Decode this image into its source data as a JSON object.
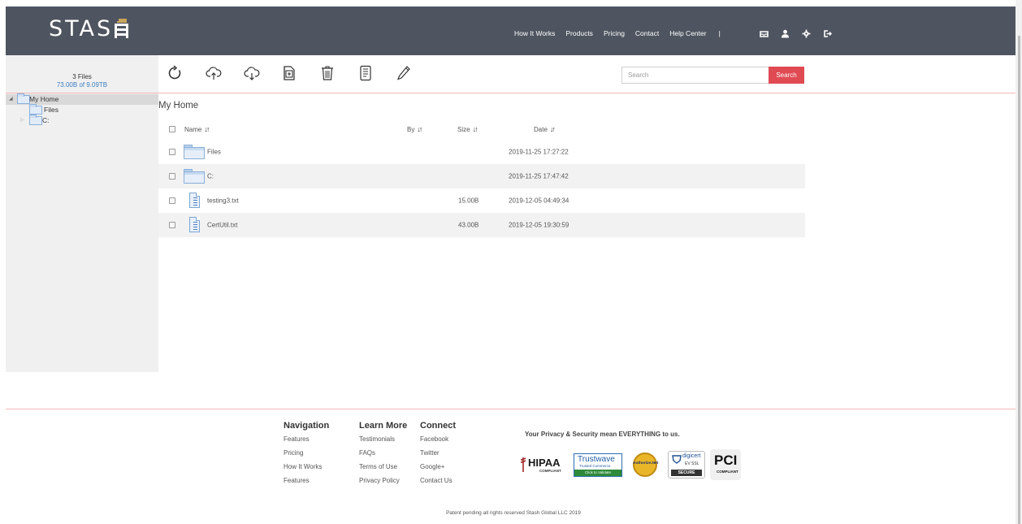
{
  "brand": {
    "logo_text": "STAS"
  },
  "topnav": {
    "links": [
      "How It Works",
      "Products",
      "Pricing",
      "Contact",
      "Help Center"
    ],
    "separator": "|",
    "icons": [
      "inbox-icon",
      "user-icon",
      "gear-icon",
      "logout-icon"
    ]
  },
  "sidebar": {
    "file_count": "3 Files",
    "usage": "73.00B of 9.09TB",
    "tree": [
      {
        "label": "My Home",
        "expanded": true,
        "selected": true
      },
      {
        "label": "Files",
        "expanded": false,
        "selected": false
      },
      {
        "label": "C:",
        "expanded": false,
        "selected": false
      }
    ]
  },
  "toolbar": {
    "icons": [
      "refresh-icon",
      "cloud-upload-icon",
      "cloud-download-icon",
      "new-folder-icon",
      "trash-icon",
      "document-icon",
      "pencil-icon"
    ]
  },
  "search": {
    "placeholder": "Search",
    "button_label": "Search"
  },
  "main": {
    "breadcrumb": "My Home",
    "columns": {
      "name": "Name",
      "by": "By",
      "size": "Size",
      "date": "Date"
    },
    "rows": [
      {
        "type": "folder",
        "name": "Files",
        "by": "",
        "size": "",
        "date": "2019-11-25 17:27:22"
      },
      {
        "type": "folder",
        "name": "C:",
        "by": "",
        "size": "",
        "date": "2019-11-25 17:47:42"
      },
      {
        "type": "file",
        "name": "testing3.txt",
        "by": "",
        "size": "15.00B",
        "date": "2019-12-05 04:49:34"
      },
      {
        "type": "file",
        "name": "CertUtil.txt",
        "by": "",
        "size": "43.00B",
        "date": "2019-12-05 19:30:59"
      }
    ]
  },
  "footer": {
    "navigation": {
      "title": "Navigation",
      "links": [
        "Features",
        "Pricing",
        "How It Works",
        "Features"
      ]
    },
    "learn_more": {
      "title": "Learn More",
      "links": [
        "Testimonials",
        "FAQs",
        "Terms of Use",
        "Privacy Policy"
      ]
    },
    "connect": {
      "title": "Connect",
      "links": [
        "Facebook",
        "Twitter",
        "Google+",
        "Contact Us"
      ]
    },
    "privacy_note": "Your Privacy & Security mean EVERYTHING to us.",
    "badges": [
      {
        "name": "hipaa",
        "text": "HIPAA",
        "sub": "COMPLIANT"
      },
      {
        "name": "trustwave",
        "text": "Trustwave",
        "sub": "Trusted Commerce",
        "cta": "Click to Validate"
      },
      {
        "name": "authorize-net",
        "text": "Authorize.Net"
      },
      {
        "name": "digicert",
        "text": "digicert",
        "sub": "EV SSL",
        "cta": "SECURE"
      },
      {
        "name": "pci",
        "text": "PCI",
        "sub": "COMPLIANT"
      }
    ],
    "copyright": "Patent pending all rights reserved Stash Global LLC 2019"
  },
  "colors": {
    "header_bg": "#4f5560",
    "accent_red": "#df4a53",
    "link_blue": "#3a7dc0",
    "logo_gold": "#c9a45c"
  }
}
